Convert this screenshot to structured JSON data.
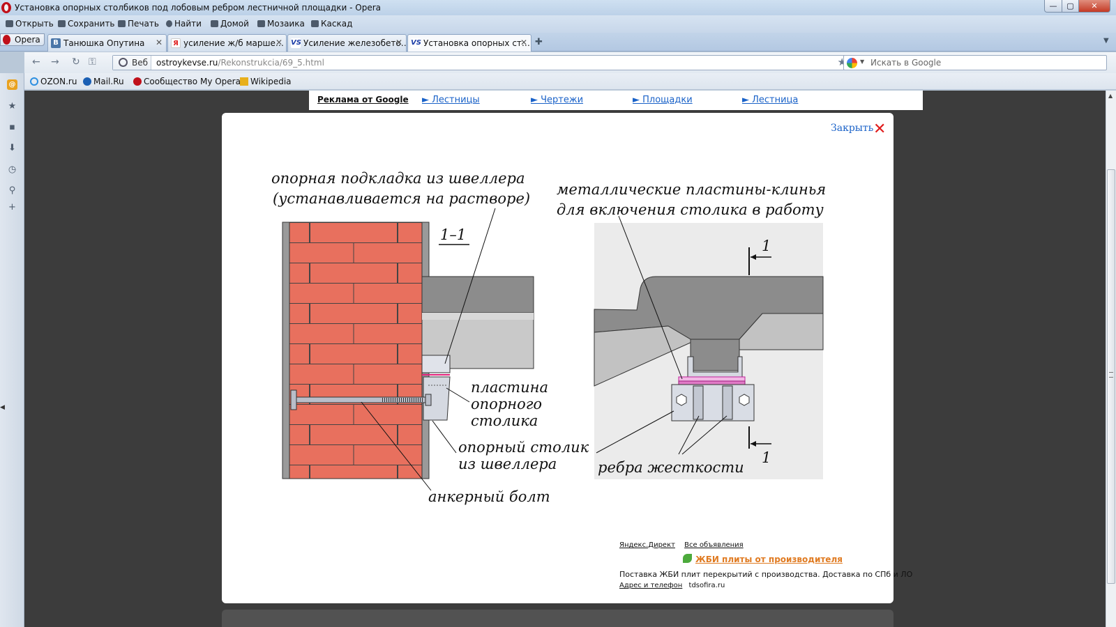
{
  "window": {
    "title": "Установка опорных столбиков под лобовым ребром лестничной площадки - Opera",
    "controls": {
      "minimize": "—",
      "maximize": "▢",
      "close": "✕"
    }
  },
  "menu": [
    "Открыть",
    "Сохранить",
    "Печать",
    "Найти",
    "Домой",
    "Мозаика",
    "Каскад"
  ],
  "opera_button": "Opera",
  "tabs": [
    {
      "label": "Танюшка Опутина",
      "icon": "В",
      "icon_color": "#4a76a8"
    },
    {
      "label": "усиление ж/б марше…",
      "icon": "Я",
      "icon_color": "#ffffff"
    },
    {
      "label": "Усиление железобето…",
      "icon": "VS",
      "icon_color": "#ffffff"
    },
    {
      "label": "Установка опорных ст…",
      "icon": "VS",
      "icon_color": "#ffffff",
      "active": true
    }
  ],
  "address": {
    "web_label": "Веб",
    "domain": "ostroykevse.ru",
    "path": "/Rekonstrukcia/69_5.html"
  },
  "search": {
    "placeholder": "Искать в Google"
  },
  "bookmarks": [
    {
      "label": "OZON.ru",
      "icon_color": "#2d8fe0"
    },
    {
      "label": "Mail.Ru",
      "icon_color": "#1a5fb4"
    },
    {
      "label": "Сообщество My Opera",
      "icon_color": "#c0101a"
    },
    {
      "label": "Wikipedia",
      "icon_color": "#e8b01c"
    }
  ],
  "adbar": {
    "label": "Реклама от Google",
    "links": [
      "► Лестницы",
      "► Чертежи",
      "► Площадки",
      "► Лестница"
    ]
  },
  "modal": {
    "close_label": "Закрыть",
    "close_icon": "✕"
  },
  "drawing": {
    "label_support": "опорная подкладка из швеллера",
    "label_support_2": "(устанавливается на растворе)",
    "label_plates": "металлические пластины-клинья",
    "label_plates_2": "для включения столика в работу",
    "label_section": "1–1",
    "label_plate": "пластина",
    "label_plate_2": "опорного",
    "label_plate_3": "столика",
    "label_table": "опорный столик",
    "label_table_2": "из швеллера",
    "label_bolt": "анкерный болт",
    "label_ribs": "ребра жесткости",
    "label_cut_top": "1",
    "label_cut_bottom": "1",
    "colors": {
      "brick": "#e8705e",
      "concrete": "#8c8c8c",
      "concrete_light": "#c2c2c2",
      "panel_bg": "#ebebeb",
      "steel": "#d9dde5",
      "plate": "#e07ac6"
    }
  },
  "direct": {
    "links": [
      "Яндекс.Директ",
      "Все объявления"
    ],
    "title": "ЖБИ плиты от производителя",
    "description": "Поставка ЖБИ плит перекрытий с производства. Доставка по СПб и ЛО",
    "contact_link": "Адрес и телефон",
    "domain": "tdsofira.ru"
  }
}
